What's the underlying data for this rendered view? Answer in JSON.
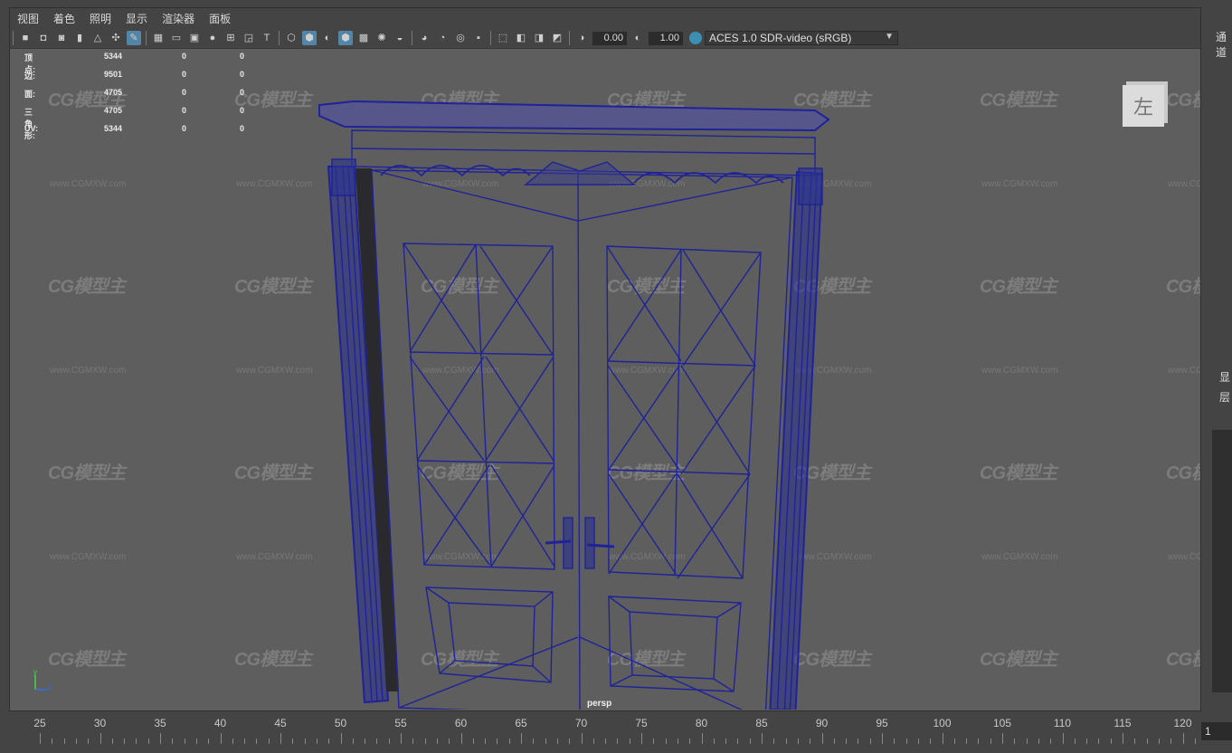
{
  "menu": [
    "视图",
    "着色",
    "照明",
    "显示",
    "渲染器",
    "面板"
  ],
  "toolbar": {
    "exposure_value": "0.00",
    "gamma_value": "1.00",
    "color_space": "ACES 1.0 SDR-video (sRGB)"
  },
  "hud": {
    "rows": [
      {
        "label": "顶点:",
        "v1": "5344",
        "v2": "0",
        "v3": "0"
      },
      {
        "label": "边:",
        "v1": "9501",
        "v2": "0",
        "v3": "0"
      },
      {
        "label": "面:",
        "v1": "4705",
        "v2": "0",
        "v3": "0"
      },
      {
        "label": "三角形:",
        "v1": "4705",
        "v2": "0",
        "v3": "0"
      },
      {
        "label": "UV:",
        "v1": "5344",
        "v2": "0",
        "v3": "0"
      }
    ]
  },
  "viewcube_label": "左",
  "camera_name": "persp",
  "watermark": {
    "logo": "CG模型主",
    "url": "www.CGMXW.com"
  },
  "right_panel": {
    "top_label": "通道",
    "label_a": "显",
    "label_b": "层"
  },
  "timeline": {
    "ticks": [
      "25",
      "30",
      "35",
      "40",
      "45",
      "50",
      "55",
      "60",
      "65",
      "70",
      "75",
      "80",
      "85",
      "90",
      "95",
      "100",
      "105",
      "110",
      "115",
      "120"
    ],
    "current_frame": "1"
  },
  "colors": {
    "wireframe": "#1f2299",
    "viewport_bg": "#5e5e5e",
    "active_tool": "#5285a6"
  },
  "axis": {
    "y": "y",
    "z": "z"
  }
}
